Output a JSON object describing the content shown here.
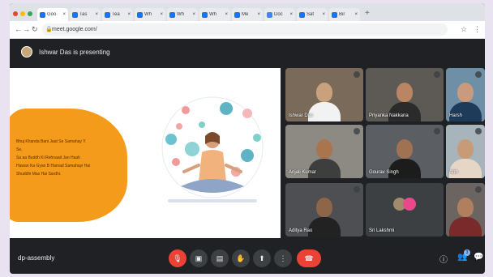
{
  "browser": {
    "tabs": [
      {
        "label": "Goo",
        "color": "#1a73e8",
        "active": true
      },
      {
        "label": "Tas",
        "color": "#1a73e8"
      },
      {
        "label": "Tea",
        "color": "#1a73e8"
      },
      {
        "label": "Wh",
        "color": "#1a73e8"
      },
      {
        "label": "Wh",
        "color": "#1a73e8"
      },
      {
        "label": "Wh",
        "color": "#1a73e8"
      },
      {
        "label": "Me",
        "color": "#1a73e8"
      },
      {
        "label": "Doc",
        "color": "#4285f4"
      },
      {
        "label": "Sat",
        "color": "#1a73e8"
      },
      {
        "label": "Bir",
        "color": "#1a73e8"
      }
    ],
    "new_tab": "+",
    "url": "meet.google.com/",
    "lock_icon": "lock-icon"
  },
  "meet": {
    "presenting_text": "Ishwar Das is presenting",
    "slide": {
      "lines": [
        "Bhuj Khanda Bani Jaat Se Samahay Y.",
        "Se,",
        "Sa aa Buddh Ki Rehnaait Jan Haah",
        "Hawan Ka Gyan B Hamad Samahayi Hai",
        "Shuddhi Mas Hai Sardhi."
      ]
    },
    "participants": [
      {
        "name": "Ishwar Das",
        "bg": "#7a6a5a",
        "skin": "#c9a17d",
        "shirt": "#f2f2f2"
      },
      {
        "name": "Priyanka Nakkana",
        "bg": "#5d5a55",
        "skin": "#b98562",
        "shirt": "#2b2b2b"
      },
      {
        "name": "Harsh",
        "bg": "#6e8fa5",
        "skin": "#c99a7b",
        "shirt": "#1e3b5a"
      },
      {
        "name": "Anjali Kumar",
        "bg": "#8c8a83",
        "skin": "#a8754f",
        "shirt": "#3e3e3e"
      },
      {
        "name": "Gourav Singh",
        "bg": "#5b5f63",
        "skin": "#a07254",
        "shirt": "#1c1c1c"
      },
      {
        "name": "Abh",
        "bg": "#a7b4bc",
        "skin": "#c79b77",
        "shirt": "#e6d6c6"
      },
      {
        "name": "Aditya Rao",
        "bg": "#4d4f52",
        "skin": "#8d6548",
        "shirt": "#222222"
      },
      {
        "name": "Sri Lakshmi",
        "bg": "#3c4043",
        "skin": "",
        "shirt": ""
      },
      {
        "name": "",
        "bg": "#6b6460",
        "skin": "#b0805e",
        "shirt": "#7a2a2a"
      }
    ],
    "bottom": {
      "meeting_code": "dp-assembly",
      "controls": [
        "mic-off-icon",
        "camera-icon",
        "captions-icon",
        "raise-hand-icon",
        "present-icon",
        "more-icon",
        "end-call-icon"
      ],
      "right_badge": "3"
    }
  },
  "colors": {
    "meet_bg": "#202124",
    "end_call": "#ea4335",
    "slide_blob": "#f59b1c"
  }
}
